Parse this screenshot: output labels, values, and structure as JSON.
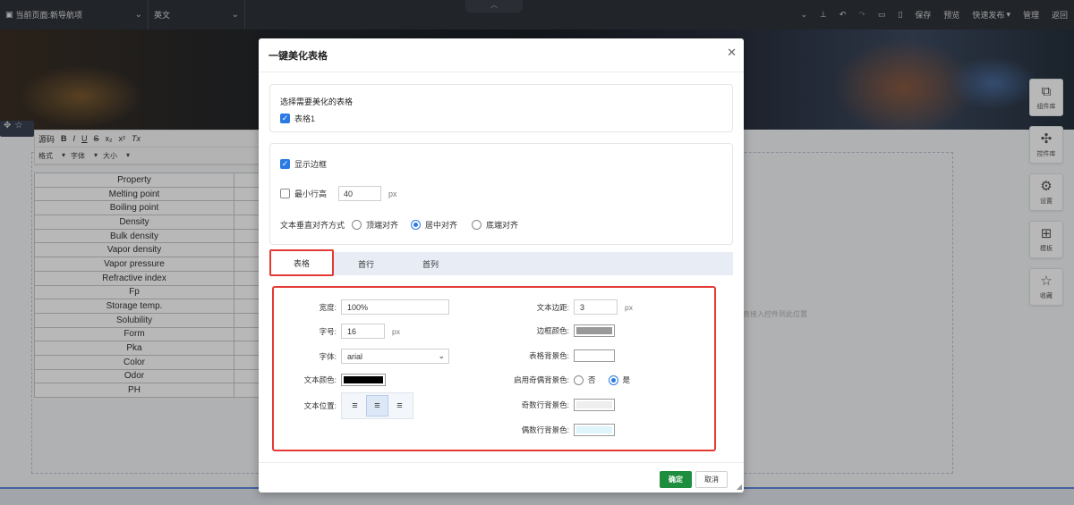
{
  "topbar": {
    "page_select": "当前页面:新导航项",
    "lang_select": "英文",
    "actions": [
      "保存",
      "预览",
      "快速发布",
      "管理",
      "返回"
    ]
  },
  "canvas": {
    "hint": "直接入控件到此位置"
  },
  "editor_toolbar": {
    "row1": [
      "源码",
      "B",
      "I",
      "U",
      "S",
      "x₂",
      "x²",
      "Tx"
    ],
    "row2": [
      "格式",
      "字体",
      "大小"
    ]
  },
  "property_table": {
    "rows": [
      "Property",
      "Melting point",
      "Boiling point",
      "Density",
      "Bulk density",
      "Vapor density",
      "Vapor pressure",
      "Refractive index",
      "Fp",
      "Storage temp.",
      "Solubility",
      "Form",
      "Pka",
      "Color",
      "Odor",
      "PH"
    ]
  },
  "sidebar": {
    "items": [
      {
        "label": "组件库",
        "icon": "layers-icon"
      },
      {
        "label": "控件库",
        "icon": "puzzle-icon"
      },
      {
        "label": "设置",
        "icon": "gear-icon"
      },
      {
        "label": "模板",
        "icon": "grid-icon"
      },
      {
        "label": "收藏",
        "icon": "star-icon"
      }
    ]
  },
  "modal": {
    "title": "一键美化表格",
    "select_table": {
      "label": "选择需要美化的表格",
      "table_name": "表格1",
      "checked": true
    },
    "options": {
      "show_border": {
        "label": "显示边框",
        "checked": true
      },
      "min_row_height": {
        "label": "最小行高",
        "checked": false,
        "value": "40",
        "unit": "px"
      },
      "vertical_align": {
        "label": "文本垂直对齐方式",
        "options": [
          "顶端对齐",
          "居中对齐",
          "底端对齐"
        ],
        "selected": "居中对齐"
      }
    },
    "tabs": [
      "表格",
      "首行",
      "首列"
    ],
    "active_tab": "表格",
    "fields": {
      "width": {
        "label": "宽度:",
        "value": "100%"
      },
      "font_size": {
        "label": "字号:",
        "value": "16",
        "unit": "px"
      },
      "font_family": {
        "label": "字体:",
        "value": "arial"
      },
      "text_color": {
        "label": "文本颜色:",
        "color": "#000000"
      },
      "text_align": {
        "label": "文本位置:",
        "selected": "center"
      },
      "text_padding": {
        "label": "文本边距:",
        "value": "3",
        "unit": "px"
      },
      "border_color": {
        "label": "边框颜色:",
        "color": "#999999"
      },
      "table_bg": {
        "label": "表格背景色:",
        "color": "#ffffff"
      },
      "odd_even_bg": {
        "label": "启用奇偶背景色:",
        "options": [
          "否",
          "是"
        ],
        "selected": "是"
      },
      "odd_row_bg": {
        "label": "奇数行背景色:",
        "color": "#eeeeee"
      },
      "even_row_bg": {
        "label": "偶数行背景色:",
        "color": "#dff4fb"
      }
    },
    "buttons": {
      "ok": "确定",
      "cancel": "取消"
    }
  }
}
